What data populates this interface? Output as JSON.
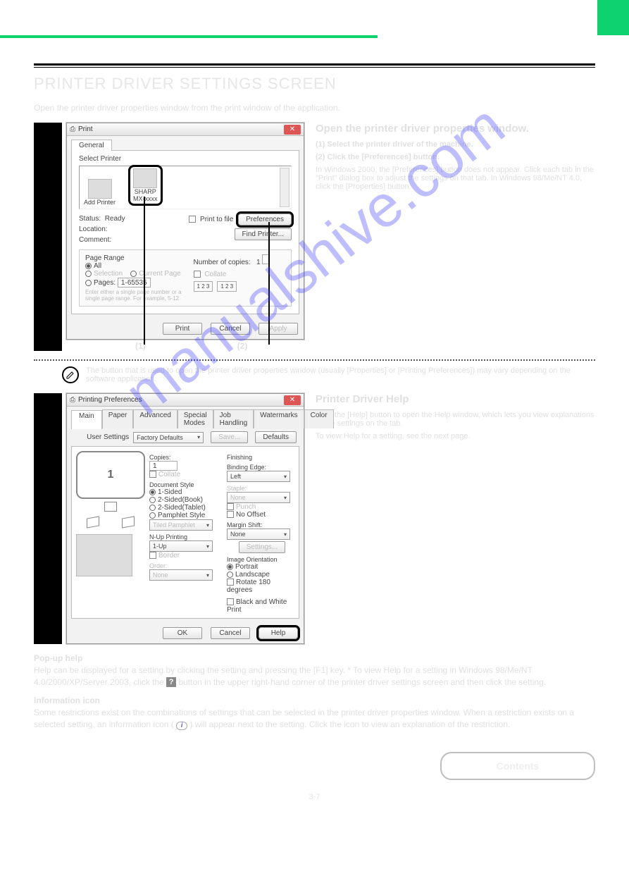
{
  "page": {
    "heading": "PRINTER DRIVER SETTINGS SCREEN",
    "intro": "Open the printer driver properties window from the print window of the application.",
    "watermark": "manualshive.com",
    "contents_label": "Contents",
    "page_number": "3-7"
  },
  "step1": {
    "title": "Open the printer driver properties window.",
    "sub1": "(1) Select the printer driver of the machine.",
    "sub2": "(2) Click the [Preferences] button.",
    "sub_note": "In Windows 2000, the [Preferences] button does not appear. Click each tab in the \"Print\" dialog box to adjust the settings on that tab. In Windows 98/Me/NT 4.0, click the [Properties] button.",
    "callout1": "(1)",
    "callout2": "(2)",
    "note_after": "The button that is used to open the printer driver properties window (usually [Properties] or [Printing Preferences]) may vary depending on the software application."
  },
  "printdlg": {
    "title": "Print",
    "tab_general": "General",
    "select_printer": "Select Printer",
    "add_printer": "Add Printer",
    "sharp": "SHARP",
    "model": "MX-xxxx",
    "status_lbl": "Status:",
    "status_val": "Ready",
    "location_lbl": "Location:",
    "comment_lbl": "Comment:",
    "print_to_file": "Print to file",
    "preferences": "Preferences",
    "find_printer": "Find Printer...",
    "page_range": "Page Range",
    "all": "All",
    "selection": "Selection",
    "current": "Current Page",
    "pages": "Pages:",
    "pages_val": "1-65535",
    "pages_hint": "Enter either a single page number or a single page range. For example, 5-12",
    "num_copies_lbl": "Number of copies:",
    "num_copies_val": "1",
    "collate": "Collate",
    "btn_print": "Print",
    "btn_cancel": "Cancel",
    "btn_apply": "Apply"
  },
  "step2": {
    "title": "Printer Driver Help",
    "desc": "Click the [Help] button to open the Help window, which lets you view explanations of the settings on the tab.",
    "note": "To view Help for a setting, see the next page."
  },
  "prefdlg": {
    "title": "Printing Preferences",
    "tabs": {
      "main": "Main",
      "paper": "Paper",
      "advanced": "Advanced",
      "special": "Special Modes",
      "job": "Job Handling",
      "wm": "Watermarks",
      "color": "Color"
    },
    "user_settings": "User Settings",
    "user_sel": "Factory Defaults",
    "save": "Save...",
    "defaults": "Defaults",
    "copies": "Copies:",
    "copies_val": "1",
    "collate": "Collate",
    "doc_style": "Document Style",
    "one_sided": "1-Sided",
    "two_book": "2-Sided(Book)",
    "two_tablet": "2-Sided(Tablet)",
    "pamphlet": "Pamphlet Style",
    "tiled": "Tiled Pamphlet",
    "nup": "N-Up Printing",
    "nup_val": "1-Up",
    "border": "Border",
    "order": "Order:",
    "order_val": "None",
    "finishing": "Finishing",
    "binding": "Binding Edge:",
    "binding_val": "Left",
    "staple": "Staple:",
    "staple_val": "None",
    "punch": "Punch",
    "nooffset": "No Offset",
    "margin": "Margin Shift:",
    "margin_val": "None",
    "settings": "Settings...",
    "orientation": "Image Orientation",
    "portrait": "Portrait",
    "landscape": "Landscape",
    "rotate": "Rotate 180 degrees",
    "bw": "Black and White Print",
    "ok": "OK",
    "cancel": "Cancel",
    "help": "Help"
  },
  "popup": {
    "heading": "Pop-up help",
    "p1_a": "Help can be displayed for a setting by clicking the setting and pressing the [F1] key. * To view Help for a setting in Windows 98/Me/NT 4.0/2000/XP/Server 2003, click the ",
    "p1_b": " button in the upper right-hand corner of the printer driver settings screen and then click the setting.",
    "info_heading": "Information icon",
    "p2_a": "Some restrictions exist on the combinations of settings that can be selected in the printer driver properties window. When a restriction exists on a selected setting, an information icon ( ",
    "p2_b": " ) will appear next to the setting. Click the icon to view an explanation of the restriction."
  }
}
